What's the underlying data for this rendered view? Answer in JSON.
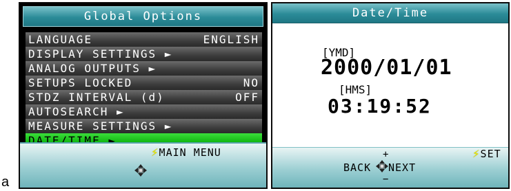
{
  "figure_label": "a",
  "global_options": {
    "title": "Global Options",
    "items": [
      {
        "label": "LANGUAGE",
        "value": "ENGLISH"
      },
      {
        "label": "DISPLAY SETTINGS ►",
        "value": ""
      },
      {
        "label": "ANALOG OUTPUTS ►",
        "value": ""
      },
      {
        "label": "SETUPS LOCKED",
        "value": "NO"
      },
      {
        "label": "STDZ INTERVAL (d)",
        "value": "OFF"
      },
      {
        "label": "AUTOSEARCH ►",
        "value": ""
      },
      {
        "label": "MEASURE SETTINGS ►",
        "value": ""
      },
      {
        "label": "DATE/TIME ►",
        "value": "",
        "selected": true
      }
    ],
    "hint_text": "MAIN MENU",
    "bolt_icon": "bolt-icon",
    "dpad_icon": "dpad-icon"
  },
  "date_time": {
    "title": "Date/Time",
    "date_format": "[YMD]",
    "date_value": "2000/01/01",
    "time_format": "[HMS]",
    "time_value": "03:19:52",
    "plus_hint": "+",
    "minus_hint": "−",
    "back_label": "BACK",
    "next_label": "NEXT",
    "set_label": "SET"
  },
  "colors": {
    "title_teal": "#2b8b98",
    "selected_green": "#12b812",
    "item_gray": "#4a4a4a",
    "bolt_yellow": "#e8e800"
  }
}
